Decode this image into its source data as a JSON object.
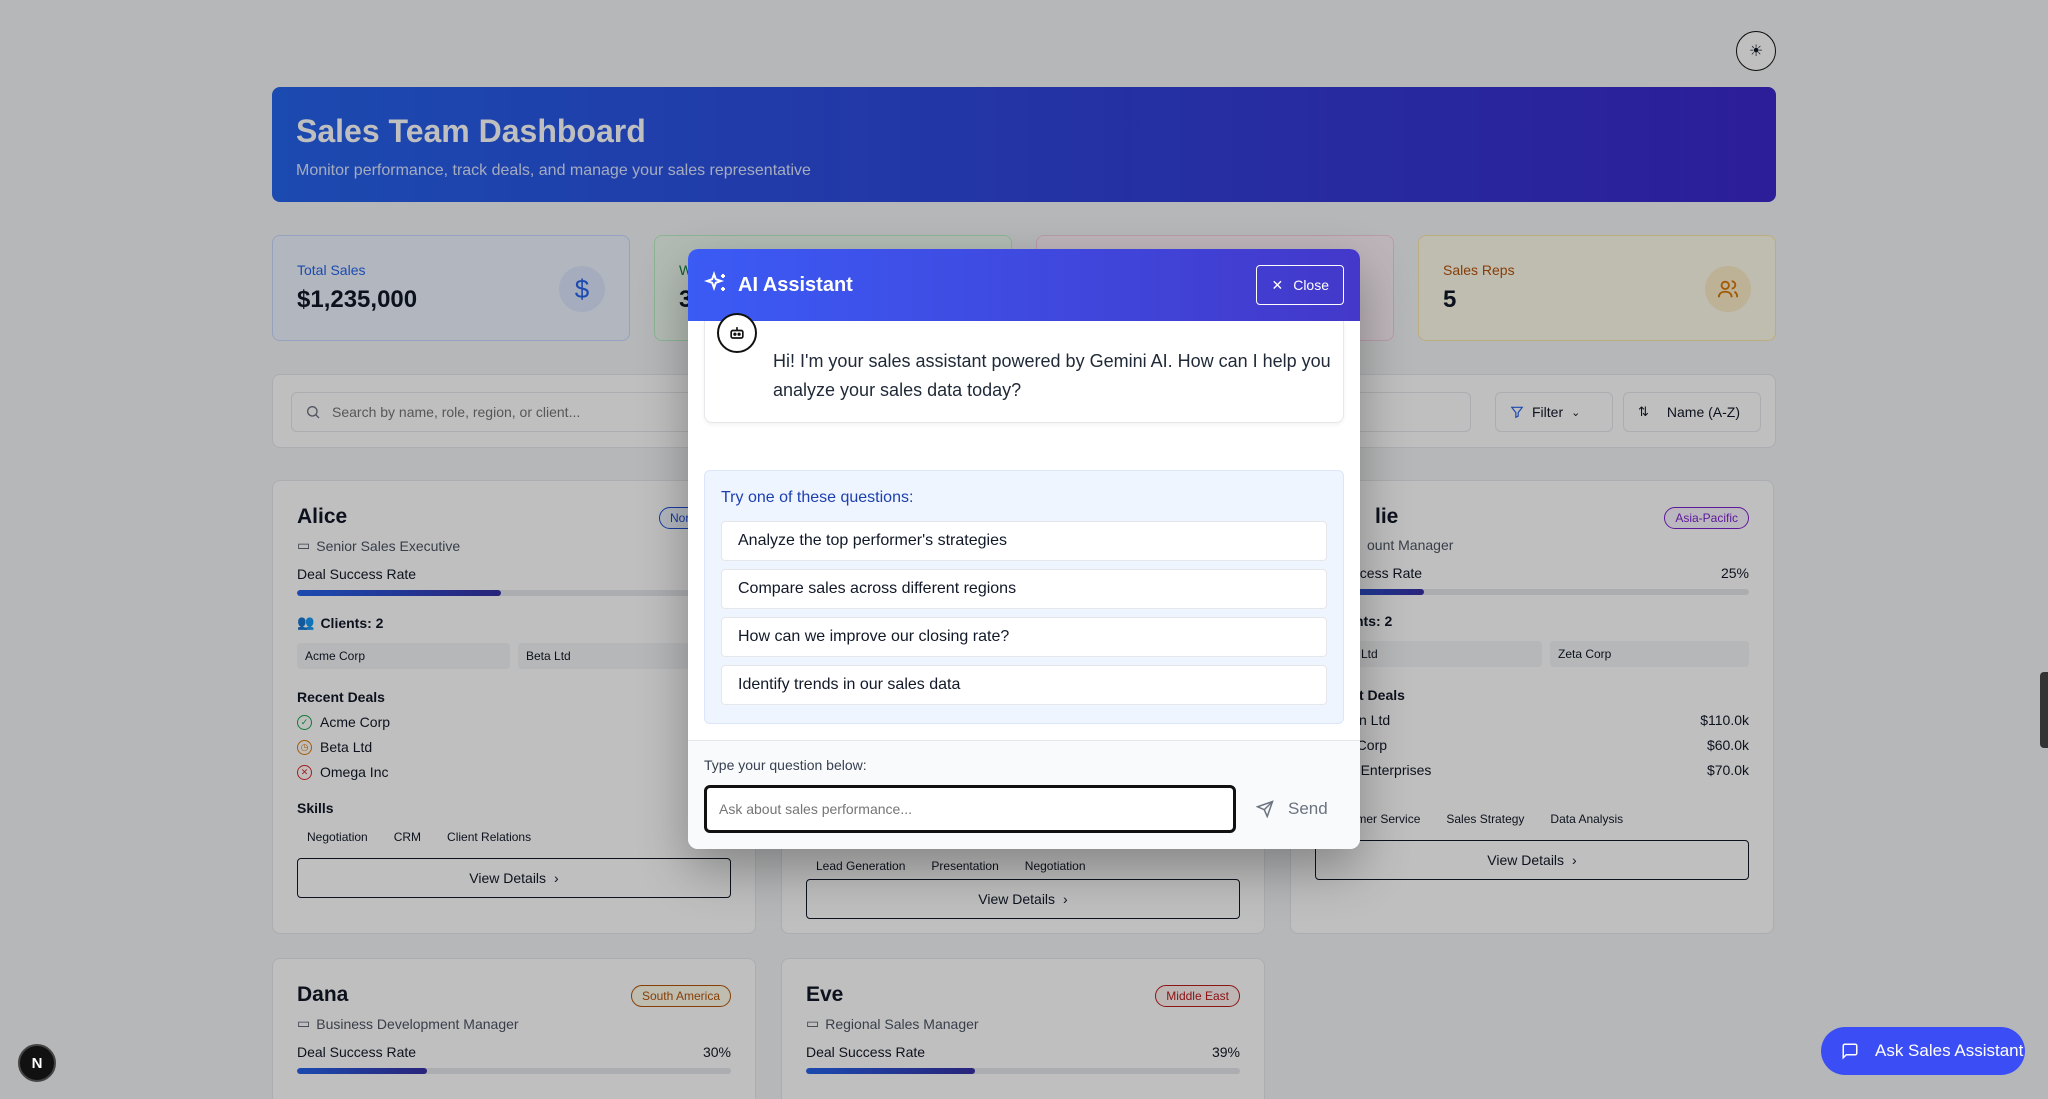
{
  "header": {
    "title": "Sales Team Dashboard",
    "subtitle": "Monitor performance, track deals, and manage your sales representative",
    "theme_toggle_icon": "sun-icon"
  },
  "stats": [
    {
      "label": "Total Sales",
      "value": "$1,235,000",
      "icon": "dollar-icon"
    },
    {
      "label": "W",
      "value": "3",
      "icon": ""
    },
    {
      "label": "",
      "value": "",
      "icon": ""
    },
    {
      "label": "Sales Reps",
      "value": "5",
      "icon": "users-icon"
    }
  ],
  "toolbar": {
    "search_placeholder": "Search by name, role, region, or client...",
    "filter_label": "Filter",
    "sort_label": "Name (A-Z)"
  },
  "cards": [
    {
      "name": "Alice",
      "region": "North Am",
      "role": "Senior Sales Executive",
      "rate_label": "Deal Success Rate",
      "rate_value": "",
      "rate_fraction": 0.47,
      "clients_label": "Clients: 2",
      "clients": [
        "Acme Corp",
        "Beta Ltd"
      ],
      "deals_label": "Recent Deals",
      "deals": [
        {
          "status": "won",
          "client": "Acme Corp",
          "amount": "$"
        },
        {
          "status": "pending",
          "client": "Beta Ltd",
          "amount": ""
        },
        {
          "status": "lost",
          "client": "Omega Inc",
          "amount": ""
        }
      ],
      "skills_label": "Skills",
      "skills": [
        "Negotiation",
        "CRM",
        "Client Relations"
      ],
      "view_label": "View Details"
    },
    {
      "name": "",
      "region": "",
      "role": "",
      "rate_label": "",
      "rate_value": "",
      "skills": [
        "Lead Generation",
        "Presentation",
        "Negotiation"
      ],
      "view_label": "View Details"
    },
    {
      "name": "lie",
      "region": "Asia-Pacific",
      "role": "ount Manager",
      "rate_label": "uccess Rate",
      "rate_value": "25%",
      "rate_fraction": 0.25,
      "clients_label": "nts: 2",
      "clients": [
        "n Ltd",
        "Zeta Corp"
      ],
      "deals_label": "t Deals",
      "deals": [
        {
          "client": "ilon Ltd",
          "amount": "$110.0k"
        },
        {
          "client": "a Corp",
          "amount": "$60.0k"
        },
        {
          "client": "ta Enterprises",
          "amount": "$70.0k"
        }
      ],
      "skills": [
        "Customer Service",
        "Sales Strategy",
        "Data Analysis"
      ],
      "view_label": "View Details"
    },
    {
      "name": "Dana",
      "region": "South America",
      "role": "Business Development Manager",
      "rate_label": "Deal Success Rate",
      "rate_value": "30%",
      "rate_fraction": 0.3
    },
    {
      "name": "Eve",
      "region": "Middle East",
      "role": "Regional Sales Manager",
      "rate_label": "Deal Success Rate",
      "rate_value": "39%",
      "rate_fraction": 0.39
    }
  ],
  "assistant": {
    "title": "AI Assistant",
    "close_label": "Close",
    "greeting": "Hi! I'm your sales assistant powered by Gemini AI. How can I help you analyze your sales data today?",
    "suggestions_heading": "Try one of these questions:",
    "suggestions": [
      "Analyze the top performer's strategies",
      "Compare sales across different regions",
      "How can we improve our closing rate?",
      "Identify trends in our sales data"
    ],
    "input_label": "Type your question below:",
    "input_placeholder": "Ask about sales performance...",
    "send_label": "Send"
  },
  "floating": {
    "ask_label": "Ask Sales Assistant",
    "badge_letter": "N"
  },
  "colors": {
    "accent": "#2563eb",
    "header_gradient_end": "#3b28cc",
    "won": "#16a34a",
    "pending": "#d97706",
    "lost": "#dc2626"
  }
}
